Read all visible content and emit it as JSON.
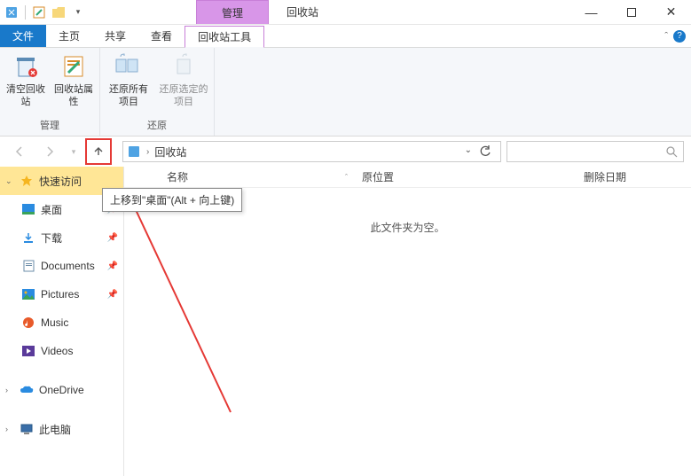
{
  "titlebar": {
    "context_tab": "管理",
    "window_title": "回收站"
  },
  "tabs": {
    "file": "文件",
    "home": "主页",
    "share": "共享",
    "view": "查看",
    "recycle_tools": "回收站工具"
  },
  "ribbon": {
    "group_manage": "管理",
    "group_restore": "还原",
    "btn_empty": "清空回收站",
    "btn_props": "回收站属性",
    "btn_restore_all": "还原所有项目",
    "btn_restore_sel": "还原选定的项目"
  },
  "nav": {
    "up_tooltip": "上移到\"桌面\"(Alt + 向上键)",
    "breadcrumb_root": "回收站",
    "chevron": "›"
  },
  "columns": {
    "name": "名称",
    "original_location": "原位置",
    "delete_date": "删除日期"
  },
  "empty": "此文件夹为空。",
  "sidebar": {
    "quick_access": "快速访问",
    "desktop": "桌面",
    "downloads": "下载",
    "documents": "Documents",
    "pictures": "Pictures",
    "music": "Music",
    "videos": "Videos",
    "onedrive": "OneDrive",
    "this_pc": "此电脑"
  }
}
